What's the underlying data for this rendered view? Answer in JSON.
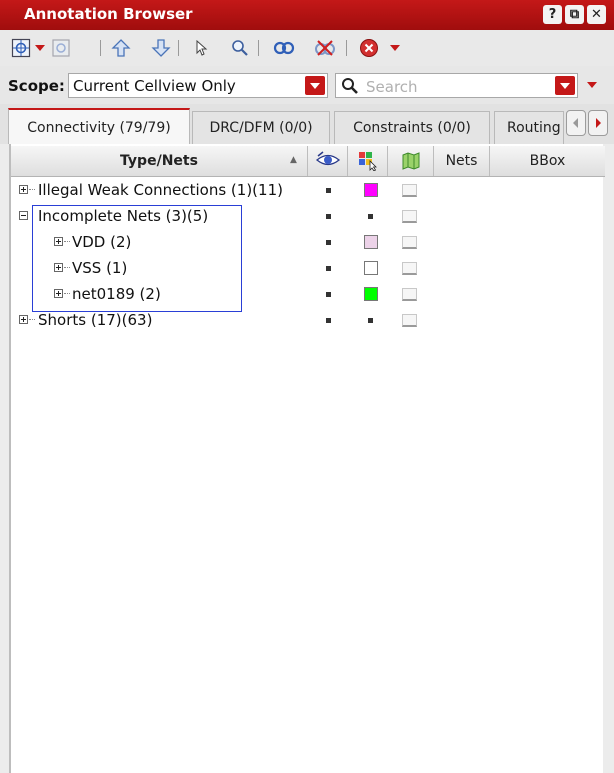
{
  "window": {
    "title": "Annotation Browser",
    "buttons": [
      "?",
      "⧉",
      "✕"
    ]
  },
  "toolbar": {
    "icons": [
      "fit-select-icon",
      "dropdown-arrow-icon",
      "zoom-area-icon",
      "up-arrow-icon",
      "down-arrow-icon",
      "pointer-icon",
      "magnifier-icon",
      "probe-icon",
      "remove-probe-icon",
      "stop-icon",
      "dropdown-arrow-icon"
    ]
  },
  "scope": {
    "label": "Scope:",
    "selected": "Current Cellview Only"
  },
  "search": {
    "placeholder": "Search"
  },
  "tabs": [
    {
      "label": "Connectivity (79/79)",
      "active": true
    },
    {
      "label": "DRC/DFM (0/0)",
      "active": false
    },
    {
      "label": "Constraints (0/0)",
      "active": false
    },
    {
      "label": "Routing",
      "active": false
    }
  ],
  "table": {
    "columns": {
      "type_nets": "Type/Nets",
      "visibility_icon": "eye-icon",
      "color_icon": "color-select-icon",
      "map_icon": "map-icon",
      "nets": "Nets",
      "bbox": "BBox"
    },
    "rows": [
      {
        "label": "Illegal Weak Connections (1)(11)",
        "level": 0,
        "expanded": false,
        "swatch": "#ff00ff"
      },
      {
        "label": "Incomplete Nets (3)(5)",
        "level": 0,
        "expanded": true,
        "swatch": null
      },
      {
        "label": "VDD (2)",
        "level": 1,
        "expanded": false,
        "swatch": "#ecd2e8"
      },
      {
        "label": "VSS (1)",
        "level": 1,
        "expanded": false,
        "swatch": "#ffffff"
      },
      {
        "label": "net0189 (2)",
        "level": 1,
        "expanded": false,
        "swatch": "#00ff00"
      },
      {
        "label": "Shorts (17)(63)",
        "level": 0,
        "expanded": false,
        "swatch": null
      }
    ]
  },
  "colors": {
    "accent": "#c41818",
    "selection_box": "#2a3fd6"
  }
}
